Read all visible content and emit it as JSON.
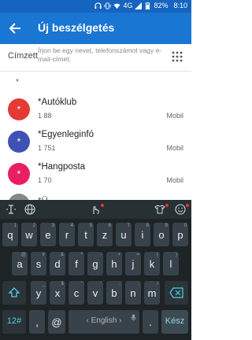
{
  "status": {
    "battery": "82%",
    "time": "8:10",
    "network": "4G"
  },
  "header": {
    "title": "Új beszélgetés"
  },
  "to_field": {
    "label": "Címzett",
    "placeholder": "Írjon be egy nevet, telefonszámot vagy e-mail-címet."
  },
  "section_header": "*",
  "contacts": [
    {
      "initial": "*",
      "name": "*Autóklub",
      "number": "1 88",
      "type": "Mobil",
      "color": "#e53935"
    },
    {
      "initial": "*",
      "name": "*Egyenleginfó",
      "number": "1 751",
      "type": "Mobil",
      "color": "#3f51b5"
    },
    {
      "initial": "*",
      "name": "*Hangposta",
      "number": "1 70",
      "type": "Mobil",
      "color": "#e91e63"
    }
  ],
  "partial_contact": {
    "name": "*Ü..."
  },
  "keyboard": {
    "row1": [
      "q",
      "w",
      "e",
      "r",
      "t",
      "z",
      "u",
      "i",
      "o",
      "p"
    ],
    "row1_hints": [
      "1",
      "2",
      "3",
      "4",
      "5",
      "6",
      "7",
      "8",
      "9",
      "0"
    ],
    "row2": [
      "a",
      "s",
      "d",
      "f",
      "g",
      "h",
      "j",
      "k",
      "l"
    ],
    "row2_hints": [
      "@",
      "#",
      "&",
      "*",
      "-",
      "+",
      "=",
      "(",
      ")"
    ],
    "row3": [
      "y",
      "x",
      "c",
      "v",
      "b",
      "n",
      "m"
    ],
    "row3_hints": [
      "_",
      "$",
      "\"",
      "'",
      ":",
      ";",
      "/"
    ],
    "numbers_key": "12#",
    "comma": ",",
    "at": "@",
    "space": "‹ English ›",
    "period": ".",
    "enter": "Kész"
  }
}
